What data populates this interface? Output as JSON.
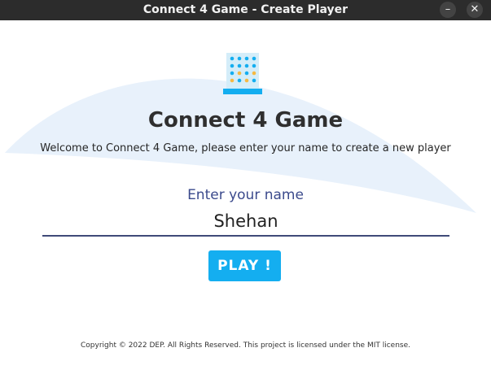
{
  "window": {
    "title": "Connect 4 Game - Create Player",
    "minimize_icon": "minimize-icon",
    "close_icon": "close-icon",
    "minimize_glyph": "–",
    "close_glyph": "✕"
  },
  "main": {
    "logo_icon": "connect-four-board-icon",
    "title": "Connect 4 Game",
    "welcome": "Welcome to Connect 4 Game, please enter your name to create a new player",
    "name_label": "Enter your name",
    "name_value": "Shehan",
    "play_label": "PLAY !",
    "copyright": "Copyright © 2022 DEP. All Rights Reserved. This project is licensed under the MIT license."
  },
  "colors": {
    "accent": "#14aef0",
    "label": "#3b4a8c",
    "titlebar": "#2c2c2c",
    "background_shape": "#e8f1fb"
  }
}
